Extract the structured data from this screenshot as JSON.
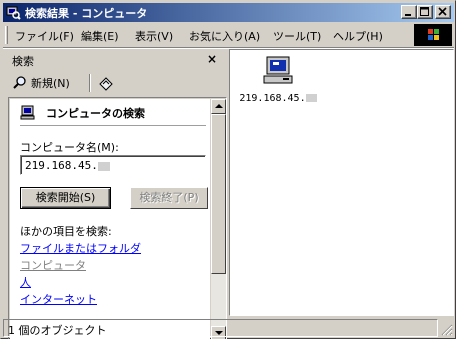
{
  "window": {
    "title": "検索結果 - コンピュータ"
  },
  "menubar": {
    "items": [
      {
        "label": "ファイル(F)"
      },
      {
        "label": "編集(E)"
      },
      {
        "label": "表示(V)"
      },
      {
        "label": "お気に入り(A)"
      },
      {
        "label": "ツール(T)"
      },
      {
        "label": "ヘルプ(H)"
      }
    ]
  },
  "search_pane": {
    "header": "検索",
    "close_glyph": "×",
    "toolbar": {
      "new_label": "新規(N)"
    },
    "section_title": "コンピュータの検索",
    "field_label": "コンピュータ名(M):",
    "field_value": "219.168.45.",
    "start_button": "検索開始(S)",
    "stop_button": "検索終了(P)",
    "others_label": "ほかの項目を検索:",
    "links": [
      {
        "label": "ファイルまたはフォルダ"
      },
      {
        "label": "コンピュータ"
      },
      {
        "label": "人"
      },
      {
        "label": "インターネット"
      }
    ]
  },
  "results": {
    "items": [
      {
        "label": "219.168.45.",
        "icon": "computer-icon"
      }
    ]
  },
  "statusbar": {
    "text": "1 個のオブジェクト"
  },
  "colors": {
    "titlebar_start": "#0a246a",
    "titlebar_end": "#a6caf0",
    "link": "#0000ff",
    "face": "#d4d0c8"
  }
}
